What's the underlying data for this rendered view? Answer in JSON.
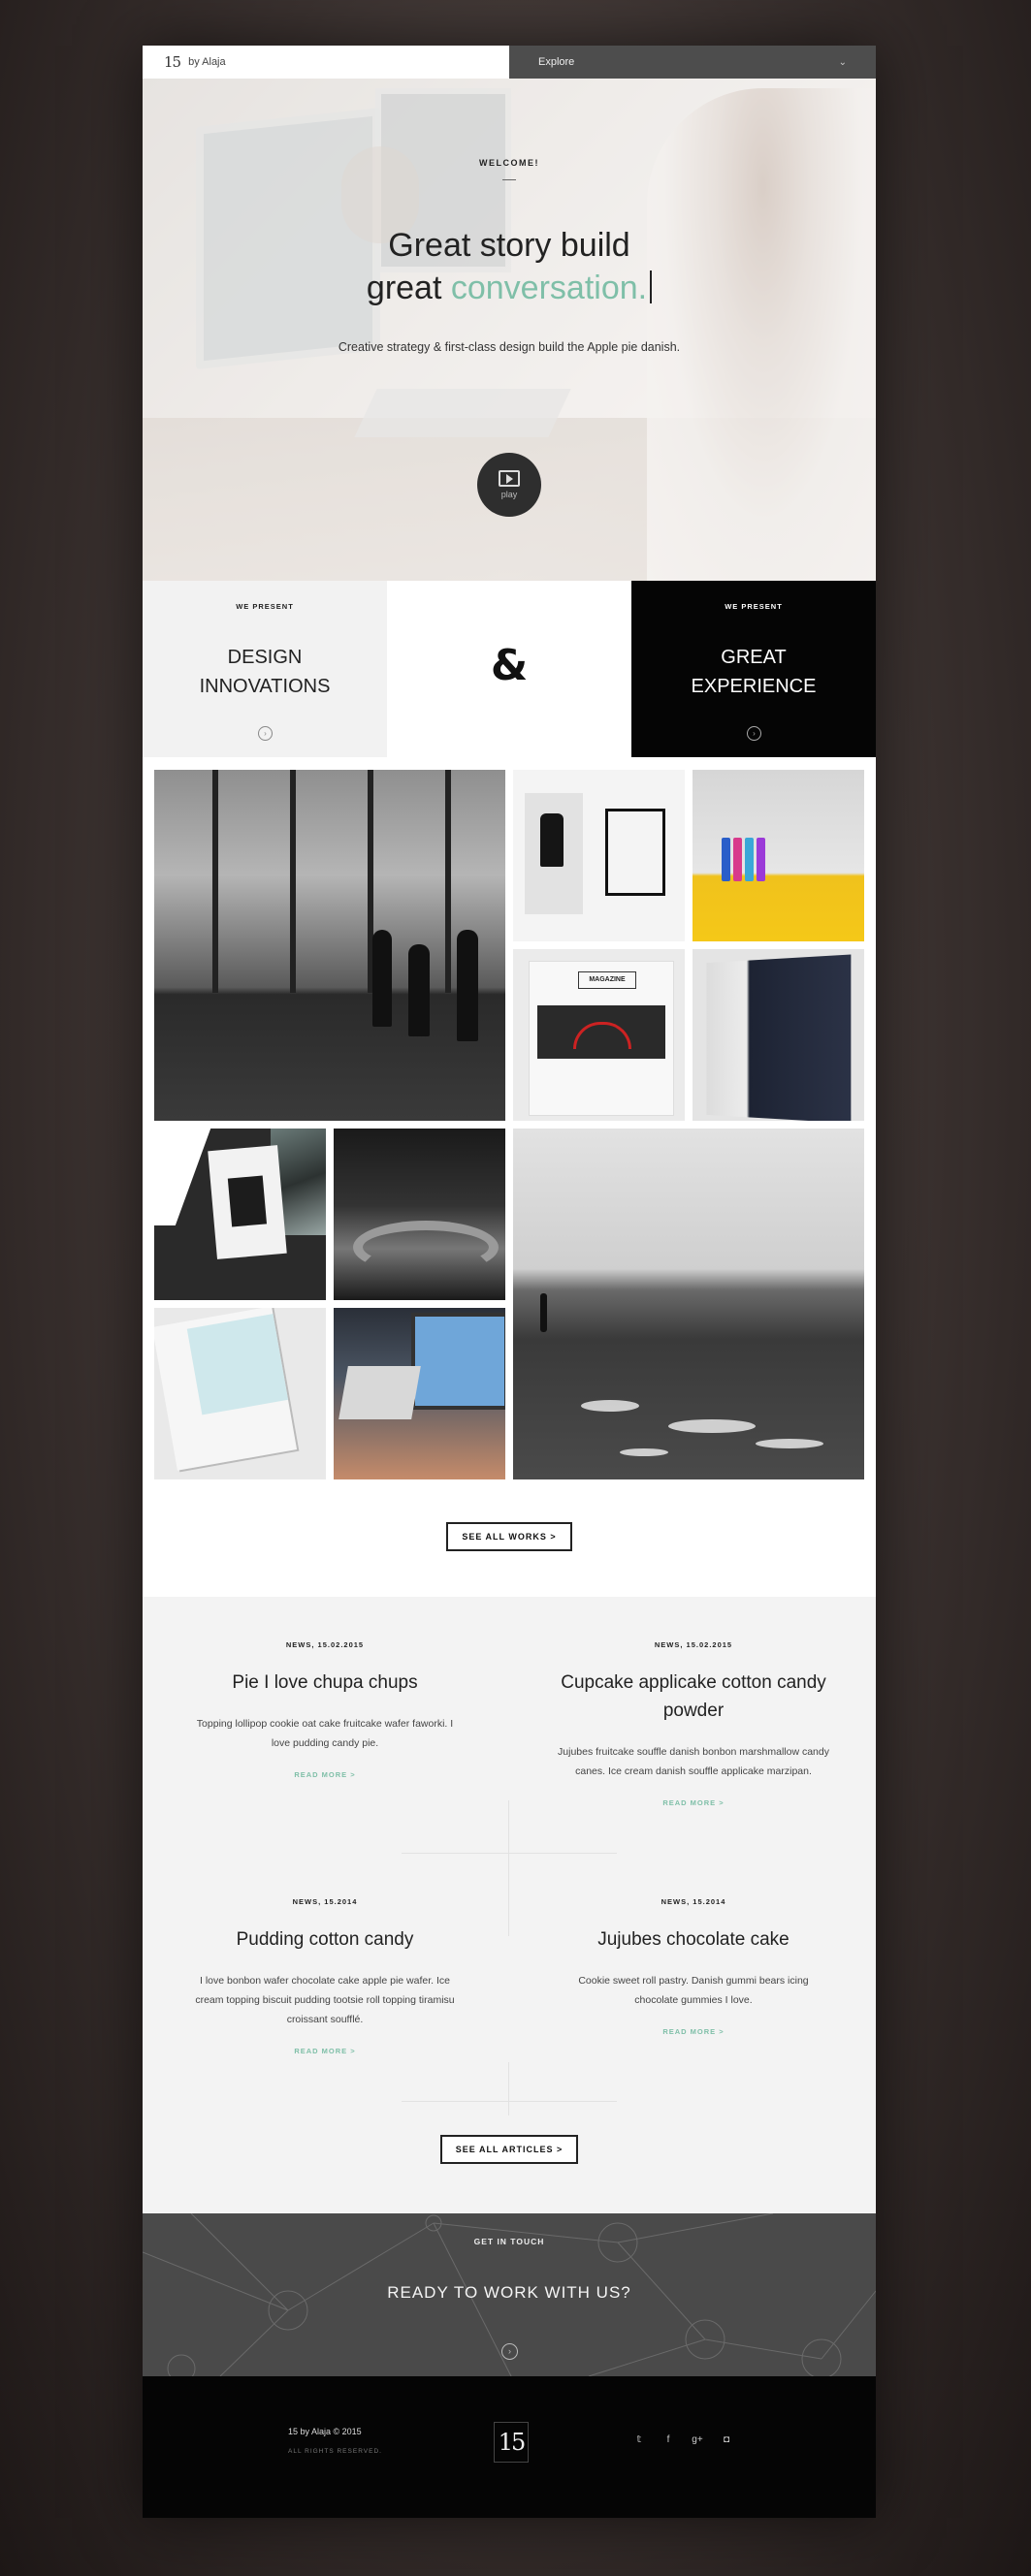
{
  "topbar": {
    "logo": "15",
    "brand": "by Alaja",
    "explore_label": "Explore",
    "explore_icon": "chevron-down-icon"
  },
  "hero": {
    "kicker": "WELCOME!",
    "headline_line1": "Great story build",
    "headline_plain": "great ",
    "headline_accent": "conversation.",
    "subline": "Creative strategy & first-class design build the Apple pie danish.",
    "play_label": "play",
    "accent_color": "#7fbfa8"
  },
  "present": {
    "left_kicker": "WE PRESENT",
    "left_title_1": "DESIGN",
    "left_title_2": "INNOVATIONS",
    "amp": "&",
    "right_kicker": "WE PRESENT",
    "right_title_1": "GREAT",
    "right_title_2": "EXPERIENCE",
    "arrow_icon": "›"
  },
  "gallery": {
    "magazine_title": "MAGAZINE"
  },
  "works_button": "SEE ALL WORKS >",
  "news": {
    "articles": [
      {
        "date": "NEWS, 15.02.2015",
        "title": "Pie I love chupa chups",
        "body": "Topping lollipop cookie oat cake fruitcake wafer faworki. I love pudding candy pie.",
        "more": "READ MORE >"
      },
      {
        "date": "NEWS, 15.02.2015",
        "title": "Cupcake applicake cotton candy powder",
        "body": "Jujubes fruitcake souffle danish bonbon marshmallow candy canes. Ice cream danish souffle applicake marzipan.",
        "more": "READ MORE >"
      },
      {
        "date": "NEWS, 15.2014",
        "title": "Pudding cotton candy",
        "body": "I love bonbon wafer chocolate cake apple pie wafer. Ice cream topping biscuit pudding tootsie roll topping tiramisu croissant soufflé.",
        "more": "READ MORE >"
      },
      {
        "date": "NEWS, 15.2014",
        "title": "Jujubes chocolate cake",
        "body": "Cookie sweet roll pastry. Danish gummi bears icing chocolate gummies I love.",
        "more": "READ MORE >"
      }
    ],
    "all_button": "SEE ALL ARTICLES >"
  },
  "touch": {
    "kicker": "GET IN TOUCH",
    "title": "READY TO WORK WITH US?",
    "arrow_icon": "›"
  },
  "footer": {
    "copyright": "15 by Alaja © 2015",
    "rights": "ALL RIGHTS RESERVED.",
    "logo": "15",
    "social": [
      "twitter-icon",
      "facebook-icon",
      "google-plus-icon",
      "instagram-icon"
    ],
    "social_glyphs": [
      "𝕥",
      "f",
      "g+",
      "◘"
    ]
  }
}
